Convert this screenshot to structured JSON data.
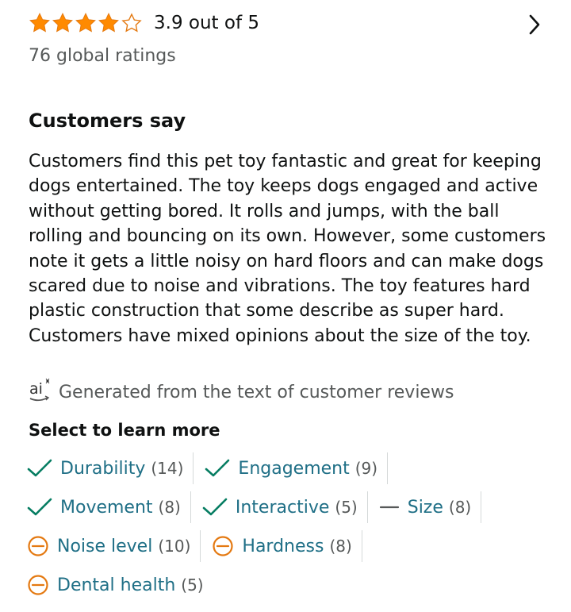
{
  "rating": {
    "value": 3.9,
    "text": "3.9 out of 5",
    "global_ratings": "76 global ratings",
    "star_color": "#ff8a00"
  },
  "customers_say": {
    "heading": "Customers say",
    "summary": "Customers find this pet toy fantastic and great for keeping dogs entertained. The toy keeps dogs engaged and active without getting bored. It rolls and jumps, with the ball rolling and bouncing on its own. However, some customers note it gets a little noisy on hard floors and can make dogs scared due to noise and vibrations. The toy features hard plastic construction that some describe as super hard. Customers have mixed opinions about the size of the toy.",
    "generated_note": "Generated from the text of customer reviews",
    "ai_logo_text": "ai"
  },
  "select": {
    "heading": "Select to learn more",
    "aspects": [
      {
        "label": "Durability",
        "count": "(14)",
        "sentiment": "positive"
      },
      {
        "label": "Engagement",
        "count": "(9)",
        "sentiment": "positive"
      },
      {
        "label": "Movement",
        "count": "(8)",
        "sentiment": "positive"
      },
      {
        "label": "Interactive",
        "count": "(5)",
        "sentiment": "positive"
      },
      {
        "label": "Size",
        "count": "(8)",
        "sentiment": "mixed"
      },
      {
        "label": "Noise level",
        "count": "(10)",
        "sentiment": "negative"
      },
      {
        "label": "Hardness",
        "count": "(8)",
        "sentiment": "negative"
      },
      {
        "label": "Dental health",
        "count": "(5)",
        "sentiment": "negative"
      }
    ]
  },
  "colors": {
    "positive": "#067d62",
    "negative": "#e47911",
    "mixed": "#565959",
    "link": "#1f6f86"
  }
}
